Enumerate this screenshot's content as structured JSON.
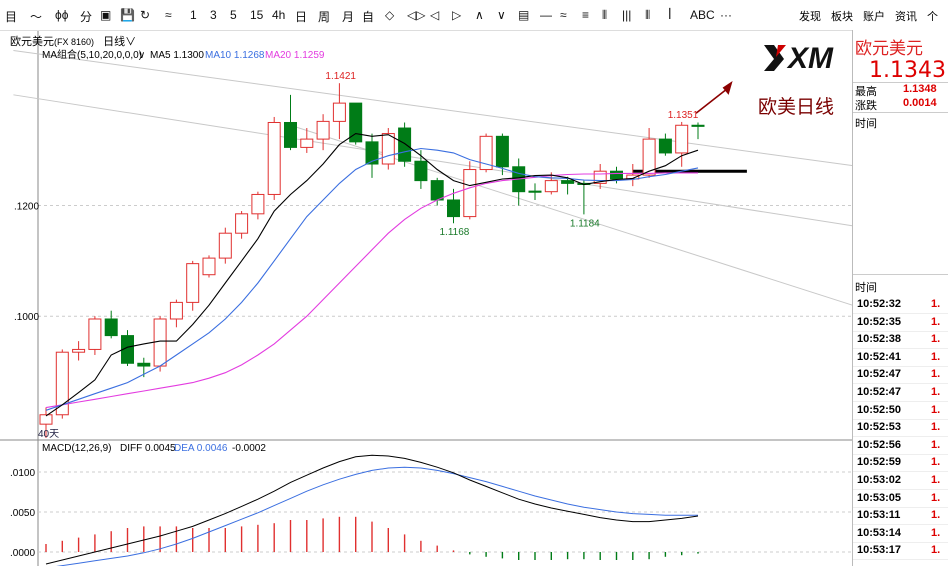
{
  "toolbar": {
    "items": [
      "目",
      "〜",
      "ϕϕ",
      "分",
      "▣",
      "💾",
      "↻",
      "≈",
      "1",
      "3",
      "5",
      "15",
      "4h",
      "日",
      "周",
      "月",
      "自",
      "◇",
      "◁▷",
      "◁",
      "▷",
      "∧",
      "∨",
      "▤",
      "—",
      "≈",
      "≡",
      "⫴",
      "|||",
      "⦀",
      "ꟾ",
      "ABC",
      "···"
    ],
    "right_items": [
      "发现",
      "板块",
      "账户",
      "资讯",
      "个"
    ]
  },
  "title": {
    "symbol": "欧元美元",
    "code": "(FX 8160)",
    "period": "日线"
  },
  "ma_legend": {
    "label": "MA组合(5,10,20,0,0,0)",
    "ma5": "MA5 1.1300",
    "ma10": "MA10 1.1268",
    "ma20": "MA20 1.1259"
  },
  "macd_legend": {
    "label": "MACD(12,26,9)",
    "diff": "DIFF 0.0045",
    "dea": "DEA 0.0046",
    "macd": "-0.0002"
  },
  "logo_text": "XM",
  "daily_label": "欧美日线",
  "colors": {
    "up": "#e0302f",
    "down": "#007c17",
    "ma5": "#000000",
    "ma10": "#3b6fe0",
    "ma20": "#e33ce0",
    "accent": "#8b0000"
  },
  "right_panel": {
    "name": "欧元美元",
    "price": "1.1343",
    "high_label": "最高",
    "high_val": "1.1348",
    "change_label": "涨跌",
    "change_val": "0.0014",
    "time_header": "时间",
    "ticks_header": "时间",
    "ticks": [
      {
        "t": "10:52:32",
        "p": "1."
      },
      {
        "t": "10:52:35",
        "p": "1."
      },
      {
        "t": "10:52:38",
        "p": "1."
      },
      {
        "t": "10:52:41",
        "p": "1."
      },
      {
        "t": "10:52:47",
        "p": "1."
      },
      {
        "t": "10:52:47",
        "p": "1."
      },
      {
        "t": "10:52:50",
        "p": "1."
      },
      {
        "t": "10:52:53",
        "p": "1."
      },
      {
        "t": "10:52:56",
        "p": "1."
      },
      {
        "t": "10:52:59",
        "p": "1."
      },
      {
        "t": "10:53:02",
        "p": "1."
      },
      {
        "t": "10:53:05",
        "p": "1."
      },
      {
        "t": "10:53:11",
        "p": "1."
      },
      {
        "t": "10:53:14",
        "p": "1."
      },
      {
        "t": "10:53:17",
        "p": "1."
      }
    ]
  },
  "chart_data": [
    {
      "type": "candlestick",
      "title": "欧元美元 日线",
      "yticks": [
        ".1200",
        ".1000"
      ],
      "ylim": [
        1.078,
        1.149
      ],
      "bottom_left_label": "40天",
      "candles": [
        {
          "o": 1.0805,
          "h": 1.0835,
          "l": 1.078,
          "c": 1.0822
        },
        {
          "o": 1.0822,
          "h": 1.094,
          "l": 1.0815,
          "c": 1.0935
        },
        {
          "o": 1.0935,
          "h": 1.0955,
          "l": 1.092,
          "c": 1.094
        },
        {
          "o": 1.094,
          "h": 1.1,
          "l": 1.093,
          "c": 1.0995
        },
        {
          "o": 1.0995,
          "h": 1.101,
          "l": 1.096,
          "c": 1.0965
        },
        {
          "o": 1.0965,
          "h": 1.0975,
          "l": 1.091,
          "c": 1.0915
        },
        {
          "o": 1.0915,
          "h": 1.0925,
          "l": 1.089,
          "c": 1.091
        },
        {
          "o": 1.091,
          "h": 1.1,
          "l": 1.09,
          "c": 1.0995
        },
        {
          "o": 1.0995,
          "h": 1.103,
          "l": 1.098,
          "c": 1.1025
        },
        {
          "o": 1.1025,
          "h": 1.11,
          "l": 1.101,
          "c": 1.1095
        },
        {
          "o": 1.1075,
          "h": 1.111,
          "l": 1.107,
          "c": 1.1105
        },
        {
          "o": 1.1105,
          "h": 1.116,
          "l": 1.1095,
          "c": 1.115
        },
        {
          "o": 1.115,
          "h": 1.119,
          "l": 1.114,
          "c": 1.1185
        },
        {
          "o": 1.1185,
          "h": 1.1225,
          "l": 1.1175,
          "c": 1.122
        },
        {
          "o": 1.122,
          "h": 1.136,
          "l": 1.121,
          "c": 1.135
        },
        {
          "o": 1.135,
          "h": 1.14,
          "l": 1.13,
          "c": 1.1305
        },
        {
          "o": 1.1305,
          "h": 1.134,
          "l": 1.1295,
          "c": 1.132
        },
        {
          "o": 1.132,
          "h": 1.1365,
          "l": 1.13,
          "c": 1.1352
        },
        {
          "o": 1.1352,
          "h": 1.1421,
          "l": 1.132,
          "c": 1.1385
        },
        {
          "o": 1.1385,
          "h": 1.1385,
          "l": 1.131,
          "c": 1.1315
        },
        {
          "o": 1.1315,
          "h": 1.133,
          "l": 1.125,
          "c": 1.1275
        },
        {
          "o": 1.1275,
          "h": 1.134,
          "l": 1.1265,
          "c": 1.133
        },
        {
          "o": 1.134,
          "h": 1.135,
          "l": 1.127,
          "c": 1.128
        },
        {
          "o": 1.128,
          "h": 1.13,
          "l": 1.123,
          "c": 1.1245
        },
        {
          "o": 1.1245,
          "h": 1.125,
          "l": 1.12,
          "c": 1.121
        },
        {
          "o": 1.121,
          "h": 1.123,
          "l": 1.1168,
          "c": 1.118
        },
        {
          "o": 1.118,
          "h": 1.128,
          "l": 1.1175,
          "c": 1.1265
        },
        {
          "o": 1.1265,
          "h": 1.133,
          "l": 1.126,
          "c": 1.1325
        },
        {
          "o": 1.1325,
          "h": 1.133,
          "l": 1.1255,
          "c": 1.127
        },
        {
          "o": 1.127,
          "h": 1.1285,
          "l": 1.12,
          "c": 1.1225
        },
        {
          "o": 1.1226,
          "h": 1.124,
          "l": 1.121,
          "c": 1.1224
        },
        {
          "o": 1.1225,
          "h": 1.126,
          "l": 1.122,
          "c": 1.1245
        },
        {
          "o": 1.1245,
          "h": 1.1252,
          "l": 1.122,
          "c": 1.124
        },
        {
          "o": 1.124,
          "h": 1.1245,
          "l": 1.1184,
          "c": 1.1238
        },
        {
          "o": 1.124,
          "h": 1.1275,
          "l": 1.123,
          "c": 1.1262
        },
        {
          "o": 1.1262,
          "h": 1.127,
          "l": 1.124,
          "c": 1.1248
        },
        {
          "o": 1.1248,
          "h": 1.1275,
          "l": 1.1235,
          "c": 1.1255
        },
        {
          "o": 1.1255,
          "h": 1.134,
          "l": 1.125,
          "c": 1.132
        },
        {
          "o": 1.132,
          "h": 1.133,
          "l": 1.129,
          "c": 1.1295
        },
        {
          "o": 1.1295,
          "h": 1.1351,
          "l": 1.127,
          "c": 1.1345
        },
        {
          "o": 1.1345,
          "h": 1.135,
          "l": 1.132,
          "c": 1.1343
        }
      ],
      "annotations": [
        {
          "text": "1.1421",
          "candle": 18,
          "at": "high"
        },
        {
          "text": "1.1168",
          "candle": 25,
          "at": "low"
        },
        {
          "text": "1.1184",
          "candle": 33,
          "at": "low"
        },
        {
          "text": "1.1351",
          "candle": 39,
          "at": "high"
        }
      ],
      "ma5": [
        1.082,
        1.084,
        1.0862,
        1.0885,
        1.093,
        1.0944,
        1.095,
        1.0955,
        1.0955,
        1.0985,
        1.102,
        1.106,
        1.11,
        1.114,
        1.119,
        1.122,
        1.1245,
        1.1275,
        1.131,
        1.133,
        1.1325,
        1.1328,
        1.1312,
        1.129,
        1.1265,
        1.1245,
        1.1236,
        1.1242,
        1.1248,
        1.125,
        1.1254,
        1.1255,
        1.125,
        1.1238,
        1.1243,
        1.1247,
        1.1249,
        1.1262,
        1.1272,
        1.129,
        1.13
      ],
      "ma10": [
        1.083,
        1.084,
        1.085,
        1.086,
        1.087,
        1.088,
        1.0895,
        1.091,
        1.093,
        1.095,
        1.097,
        1.0995,
        1.1025,
        1.106,
        1.11,
        1.114,
        1.118,
        1.121,
        1.124,
        1.1265,
        1.128,
        1.129,
        1.1297,
        1.1303,
        1.13,
        1.1295,
        1.1283,
        1.1275,
        1.1267,
        1.1258,
        1.1252,
        1.125,
        1.1249,
        1.1246,
        1.1245,
        1.1245,
        1.1247,
        1.1252,
        1.1256,
        1.1262,
        1.1268
      ],
      "ma20": [
        1.0835,
        1.084,
        1.0845,
        1.085,
        1.0855,
        1.086,
        1.0865,
        1.087,
        1.0875,
        1.088,
        1.0888,
        1.0898,
        1.0912,
        1.093,
        1.095,
        1.0975,
        1.1,
        1.103,
        1.106,
        1.109,
        1.112,
        1.115,
        1.1175,
        1.1195,
        1.121,
        1.1222,
        1.1232,
        1.124,
        1.1245,
        1.1248,
        1.1251,
        1.1254,
        1.1256,
        1.1257,
        1.1257,
        1.1258,
        1.1258,
        1.1258,
        1.1259,
        1.1259,
        1.1259
      ],
      "trendlines": [
        {
          "from": {
            "candle": -2,
            "price": 1.14
          },
          "to": {
            "candle": 50,
            "price": 1.1161
          }
        },
        {
          "from": {
            "candle": -2,
            "price": 1.148
          },
          "to": {
            "candle": 50,
            "price": 1.127
          }
        },
        {
          "from": {
            "candle": 15,
            "price": 1.1345
          },
          "to": {
            "candle": 50,
            "price": 1.1015
          }
        }
      ],
      "support": {
        "from_candle": 36,
        "to_candle": 43,
        "price": 1.1262
      }
    },
    {
      "type": "macd",
      "title": "MACD(12,26,9)",
      "yticks": [
        ".0100",
        ".0050",
        ".0000"
      ],
      "ylim": [
        -0.001,
        0.013
      ],
      "diff": [
        -0.0015,
        -0.001,
        -0.0005,
        0.0,
        0.0005,
        0.001,
        0.0015,
        0.002,
        0.0026,
        0.0032,
        0.004,
        0.0048,
        0.0057,
        0.0066,
        0.0076,
        0.0087,
        0.0096,
        0.0105,
        0.0113,
        0.0119,
        0.0121,
        0.012,
        0.0117,
        0.0112,
        0.0106,
        0.0099,
        0.009,
        0.0082,
        0.0074,
        0.0066,
        0.006,
        0.0055,
        0.0051,
        0.0047,
        0.0043,
        0.004,
        0.0038,
        0.0038,
        0.004,
        0.0042,
        0.0045
      ],
      "dea": [
        -0.002,
        -0.0017,
        -0.0014,
        -0.0011,
        -0.0008,
        -0.0005,
        -0.0001,
        0.0004,
        0.001,
        0.0017,
        0.0025,
        0.0033,
        0.0041,
        0.0049,
        0.0058,
        0.0067,
        0.0076,
        0.0084,
        0.0091,
        0.0097,
        0.0102,
        0.0105,
        0.0106,
        0.0105,
        0.0102,
        0.0098,
        0.0093,
        0.0088,
        0.0082,
        0.0076,
        0.007,
        0.0065,
        0.006,
        0.0056,
        0.0053,
        0.005,
        0.0048,
        0.0047,
        0.0046,
        0.0046,
        0.0046
      ],
      "macd": [
        0.001,
        0.0014,
        0.0018,
        0.0022,
        0.0026,
        0.003,
        0.0032,
        0.0032,
        0.0032,
        0.003,
        0.003,
        0.003,
        0.0032,
        0.0034,
        0.0036,
        0.004,
        0.004,
        0.0042,
        0.0044,
        0.0044,
        0.0038,
        0.003,
        0.0022,
        0.0014,
        0.0008,
        0.0002,
        -0.0003,
        -0.0006,
        -0.0008,
        -0.001,
        -0.001,
        -0.001,
        -0.0009,
        -0.0009,
        -0.001,
        -0.001,
        -0.001,
        -0.0009,
        -0.0006,
        -0.0004,
        -0.0002
      ]
    }
  ]
}
